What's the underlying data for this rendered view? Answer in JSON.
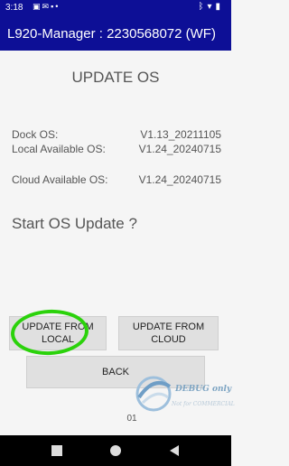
{
  "status_bar": {
    "time": "3:18",
    "left_icons": [
      "photo-icon",
      "mail-icon",
      "square-icon",
      "dot-icon"
    ],
    "right_icons": [
      "bluetooth-icon",
      "wifi-icon",
      "battery-icon"
    ]
  },
  "app_bar": {
    "title": "L920-Manager : 2230568072 (WF)"
  },
  "main": {
    "heading": "UPDATE OS",
    "rows": [
      {
        "label": "Dock OS:",
        "value": "V1.13_20211105"
      },
      {
        "label": "Local Available OS:",
        "value": "V1.24_20240715"
      },
      {
        "label": "Cloud Available OS:",
        "value": "V1.24_20240715"
      }
    ],
    "prompt": "Start OS Update ?",
    "buttons": {
      "update_local": "UPDATE FROM LOCAL",
      "update_cloud": "UPDATE FROM CLOUD",
      "back": "BACK"
    },
    "page_number": "01"
  },
  "watermark": {
    "text": "DEBUG only",
    "subtext": "Not for COMMERCIAL"
  },
  "colors": {
    "app_bar": "#0d0f96",
    "annotation_circle": "#2bd20b"
  }
}
